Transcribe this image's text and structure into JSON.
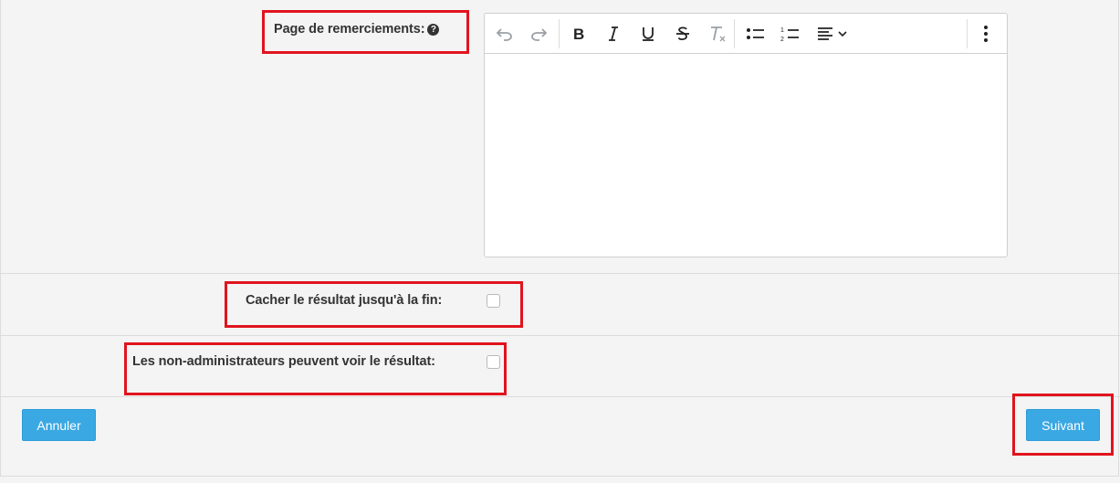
{
  "form": {
    "thank_you_label": "Page de remerciements:",
    "help_glyph": "?",
    "hide_result_label": "Cacher le résultat jusqu'à la fin:",
    "non_admin_label": "Les non-administrateurs peuvent voir le résultat:"
  },
  "editor": {
    "content": "",
    "toolbar": [
      "undo-icon",
      "redo-icon",
      "bold-icon",
      "italic-icon",
      "underline-icon",
      "strikethrough-icon",
      "clear-format-icon",
      "bullet-list-icon",
      "numbered-list-icon",
      "align-left-icon",
      "more-icon"
    ]
  },
  "checkboxes": {
    "hide_result_checked": false,
    "non_admin_checked": false
  },
  "buttons": {
    "cancel_label": "Annuler",
    "next_label": "Suivant"
  },
  "colors": {
    "accent": "#3aa8e3",
    "highlight": "#e0141e",
    "background": "#f4f4f4"
  }
}
